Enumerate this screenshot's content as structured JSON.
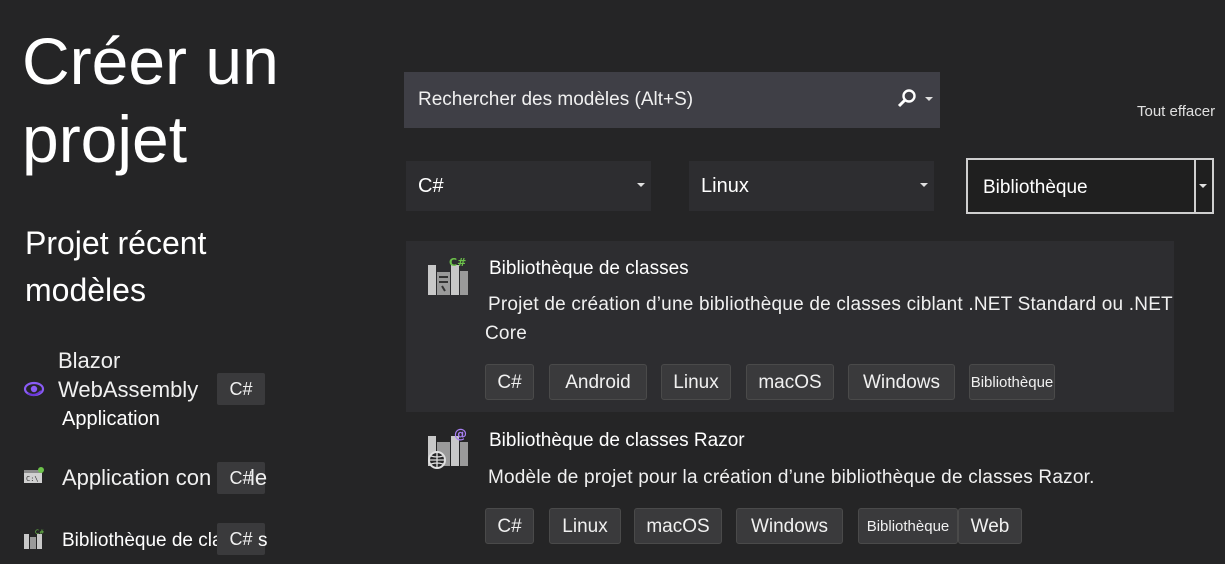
{
  "header": {
    "title_line1": "Créer un",
    "title_line2": "projet"
  },
  "recent": {
    "title_line1": "Projet récent",
    "title_line2": "modèles",
    "items": [
      {
        "label_line1": "Blazor",
        "label_line2": "WebAssembly",
        "label_line3": "Application",
        "lang": "C#",
        "icon": "blazor-icon"
      },
      {
        "label": "Application con",
        "label_tail": "le",
        "lang": "C#",
        "icon": "console-icon"
      },
      {
        "label": "Bibliothèque de cla",
        "label_tail": "s",
        "lang": "C#",
        "icon": "class-library-icon"
      }
    ]
  },
  "search": {
    "placeholder": "Rechercher des modèles (Alt+S)",
    "clear_all": "Tout effacer"
  },
  "filters": {
    "language": "C#",
    "platform": "Linux",
    "project_type": "Bibliothèque"
  },
  "templates": [
    {
      "title": "Bibliothèque de classes",
      "description_line1": "Projet de création d’une bibliothèque de classes ciblant .NET Standard ou .NET",
      "description_line2": "Core",
      "tags": [
        "C#",
        "Android",
        "Linux",
        "macOS",
        "Windows",
        "Bibliothèque"
      ],
      "icon": "class-library-icon"
    },
    {
      "title": "Bibliothèque de classes Razor",
      "description_line1": "Modèle de projet pour la création d’une bibliothèque de classes Razor.",
      "tags": [
        "C#",
        "Linux",
        "macOS",
        "Windows",
        "Bibliothèque",
        "Web"
      ],
      "icon": "razor-library-icon"
    }
  ],
  "colors": {
    "background": "#252526",
    "selected": "#2d2d30",
    "chip": "#3a3a3c",
    "accent_csharp": "#6cc24a",
    "blazor": "#7b3fe4"
  }
}
